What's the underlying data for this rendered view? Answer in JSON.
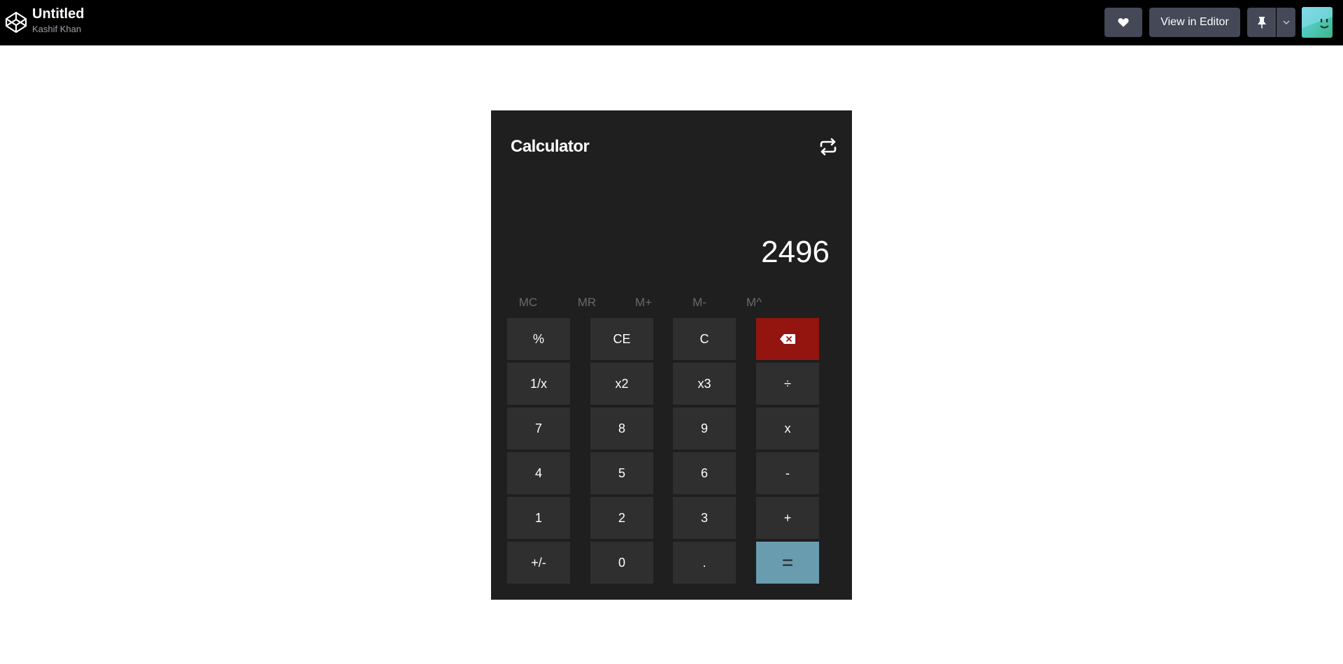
{
  "header": {
    "title": "Untitled",
    "author": "Kashif Khan",
    "view_in_editor_label": "View in Editor",
    "icons": {
      "logo": "codepen-logo-icon",
      "heart": "heart-icon",
      "pin": "pin-icon",
      "dropdown": "chevron-down-icon"
    }
  },
  "calculator": {
    "title": "Calculator",
    "display_value": "2496",
    "history_icon": "repeat-icon",
    "memory_keys": [
      "MC",
      "MR",
      "M+",
      "M-",
      "M^"
    ],
    "keys": [
      [
        "%",
        "CE",
        "C",
        "⌫"
      ],
      [
        "1/x",
        "x2",
        "x3",
        "÷"
      ],
      [
        "7",
        "8",
        "9",
        "x"
      ],
      [
        "4",
        "5",
        "6",
        "-"
      ],
      [
        "1",
        "2",
        "3",
        "+"
      ],
      [
        "+/-",
        "0",
        ".",
        "="
      ]
    ],
    "colors": {
      "background": "#1f1f1f",
      "key": "#2f2f2f",
      "backspace": "#941410",
      "equals": "#6a9cb0"
    }
  }
}
